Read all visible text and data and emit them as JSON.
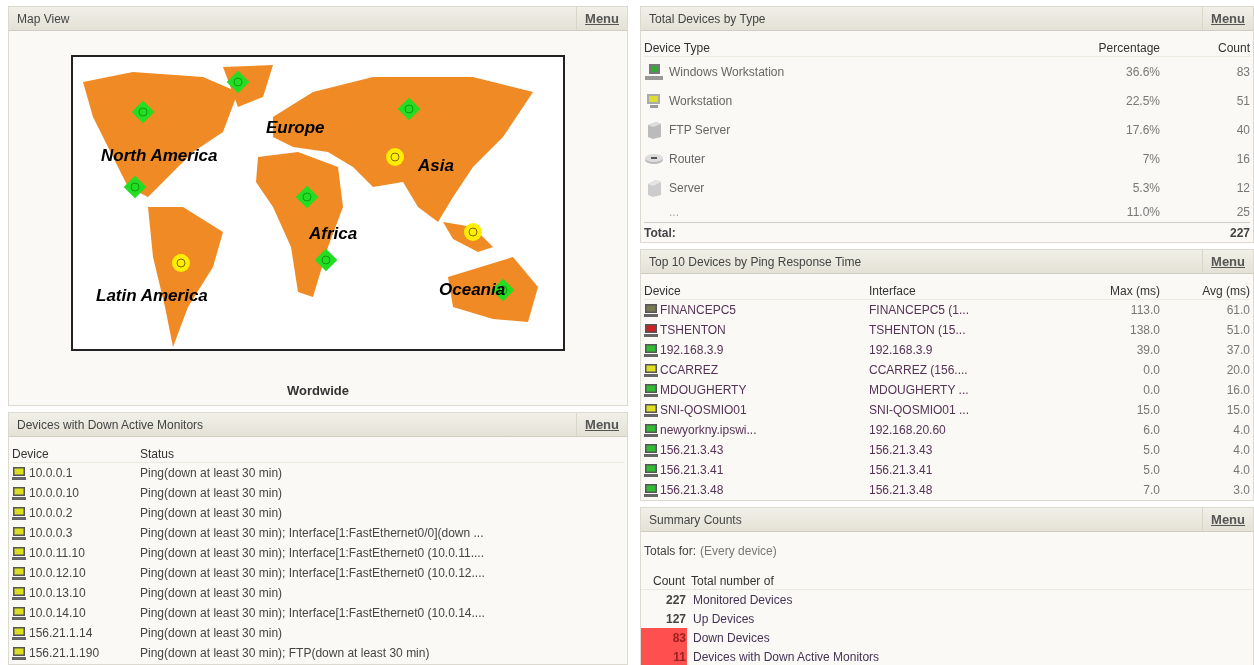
{
  "map_view": {
    "title": "Map View",
    "menu": "Menu",
    "regions": [
      "North America",
      "Europe",
      "Asia",
      "Africa",
      "Latin America",
      "Oceania"
    ],
    "caption": "Wordwide"
  },
  "down_monitors": {
    "title": "Devices with Down Active Monitors",
    "menu": "Menu",
    "columns": [
      "Device",
      "Status"
    ],
    "rows": [
      {
        "device": "10.0.0.1",
        "status": "Ping(down at least 30 min)"
      },
      {
        "device": "10.0.0.10",
        "status": "Ping(down at least 30 min)"
      },
      {
        "device": "10.0.0.2",
        "status": "Ping(down at least 30 min)"
      },
      {
        "device": "10.0.0.3",
        "status": "Ping(down at least 30 min); Interface[1:FastEthernet0/0](down ..."
      },
      {
        "device": "10.0.11.10",
        "status": "Ping(down at least 30 min); Interface[1:FastEthernet0 (10.0.11...."
      },
      {
        "device": "10.0.12.10",
        "status": "Ping(down at least 30 min); Interface[1:FastEthernet0 (10.0.12...."
      },
      {
        "device": "10.0.13.10",
        "status": "Ping(down at least 30 min)"
      },
      {
        "device": "10.0.14.10",
        "status": "Ping(down at least 30 min); Interface[1:FastEthernet0 (10.0.14...."
      },
      {
        "device": "156.21.1.14",
        "status": "Ping(down at least 30 min)"
      },
      {
        "device": "156.21.1.190",
        "status": "Ping(down at least 30 min); FTP(down at least 30 min)"
      }
    ]
  },
  "device_types": {
    "title": "Total Devices by Type",
    "menu": "Menu",
    "columns": [
      "Device Type",
      "Percentage",
      "Count"
    ],
    "rows": [
      {
        "kind": "windows",
        "type": "Windows Workstation",
        "percentage": "36.6%",
        "count": "83"
      },
      {
        "kind": "workstation",
        "type": "Workstation",
        "percentage": "22.5%",
        "count": "51"
      },
      {
        "kind": "ftp",
        "type": "FTP Server",
        "percentage": "17.6%",
        "count": "40"
      },
      {
        "kind": "router",
        "type": "Router",
        "percentage": "7%",
        "count": "16"
      },
      {
        "kind": "server",
        "type": "Server",
        "percentage": "5.3%",
        "count": "12"
      },
      {
        "kind": "other",
        "type": "...",
        "percentage": "11.0%",
        "count": "25"
      }
    ],
    "total_label": "Total:",
    "total": "227"
  },
  "ping": {
    "title": "Top 10 Devices by Ping Response Time",
    "menu": "Menu",
    "columns": [
      "Device",
      "Interface",
      "Max (ms)",
      "Avg (ms)"
    ],
    "rows": [
      {
        "device": "FINANCEPC5",
        "color": "#7a7a52",
        "interface": "FINANCEPC5 (1...",
        "max": "113.0",
        "avg": "61.0"
      },
      {
        "device": "TSHENTON",
        "color": "#cc2222",
        "interface": "TSHENTON (15...",
        "max": "138.0",
        "avg": "51.0"
      },
      {
        "device": "192.168.3.9",
        "color": "#33bb33",
        "interface": "192.168.3.9",
        "max": "39.0",
        "avg": "37.0"
      },
      {
        "device": "CCARREZ",
        "color": "#dddd22",
        "interface": "CCARREZ (156....",
        "max": "0.0",
        "avg": "20.0"
      },
      {
        "device": "MDOUGHERTY",
        "color": "#33bb33",
        "interface": "MDOUGHERTY ...",
        "max": "0.0",
        "avg": "16.0"
      },
      {
        "device": "SNI-QOSMIO01",
        "color": "#dddd22",
        "interface": "SNI-QOSMIO01 ...",
        "max": "15.0",
        "avg": "15.0"
      },
      {
        "device": "newyorkny.ipswi...",
        "color": "#33bb33",
        "interface": "192.168.20.60",
        "max": "6.0",
        "avg": "4.0"
      },
      {
        "device": "156.21.3.43",
        "color": "#33bb33",
        "interface": "156.21.3.43",
        "max": "5.0",
        "avg": "4.0"
      },
      {
        "device": "156.21.3.41",
        "color": "#33bb33",
        "interface": "156.21.3.41",
        "max": "5.0",
        "avg": "4.0"
      },
      {
        "device": "156.21.3.48",
        "color": "#33bb33",
        "interface": "156.21.3.48",
        "max": "7.0",
        "avg": "3.0"
      }
    ]
  },
  "summary": {
    "title": "Summary Counts",
    "menu": "Menu",
    "totals_label": "Totals for:",
    "totals_scope": "(Every device)",
    "columns": [
      "Count",
      "Total number of"
    ],
    "rows": [
      {
        "count": "227",
        "label": "Monitored Devices",
        "alert": false
      },
      {
        "count": "127",
        "label": "Up Devices",
        "alert": false
      },
      {
        "count": "83",
        "label": "Down Devices",
        "alert": true
      },
      {
        "count": "11",
        "label": "Devices with Down Active Monitors",
        "alert": true
      }
    ]
  }
}
